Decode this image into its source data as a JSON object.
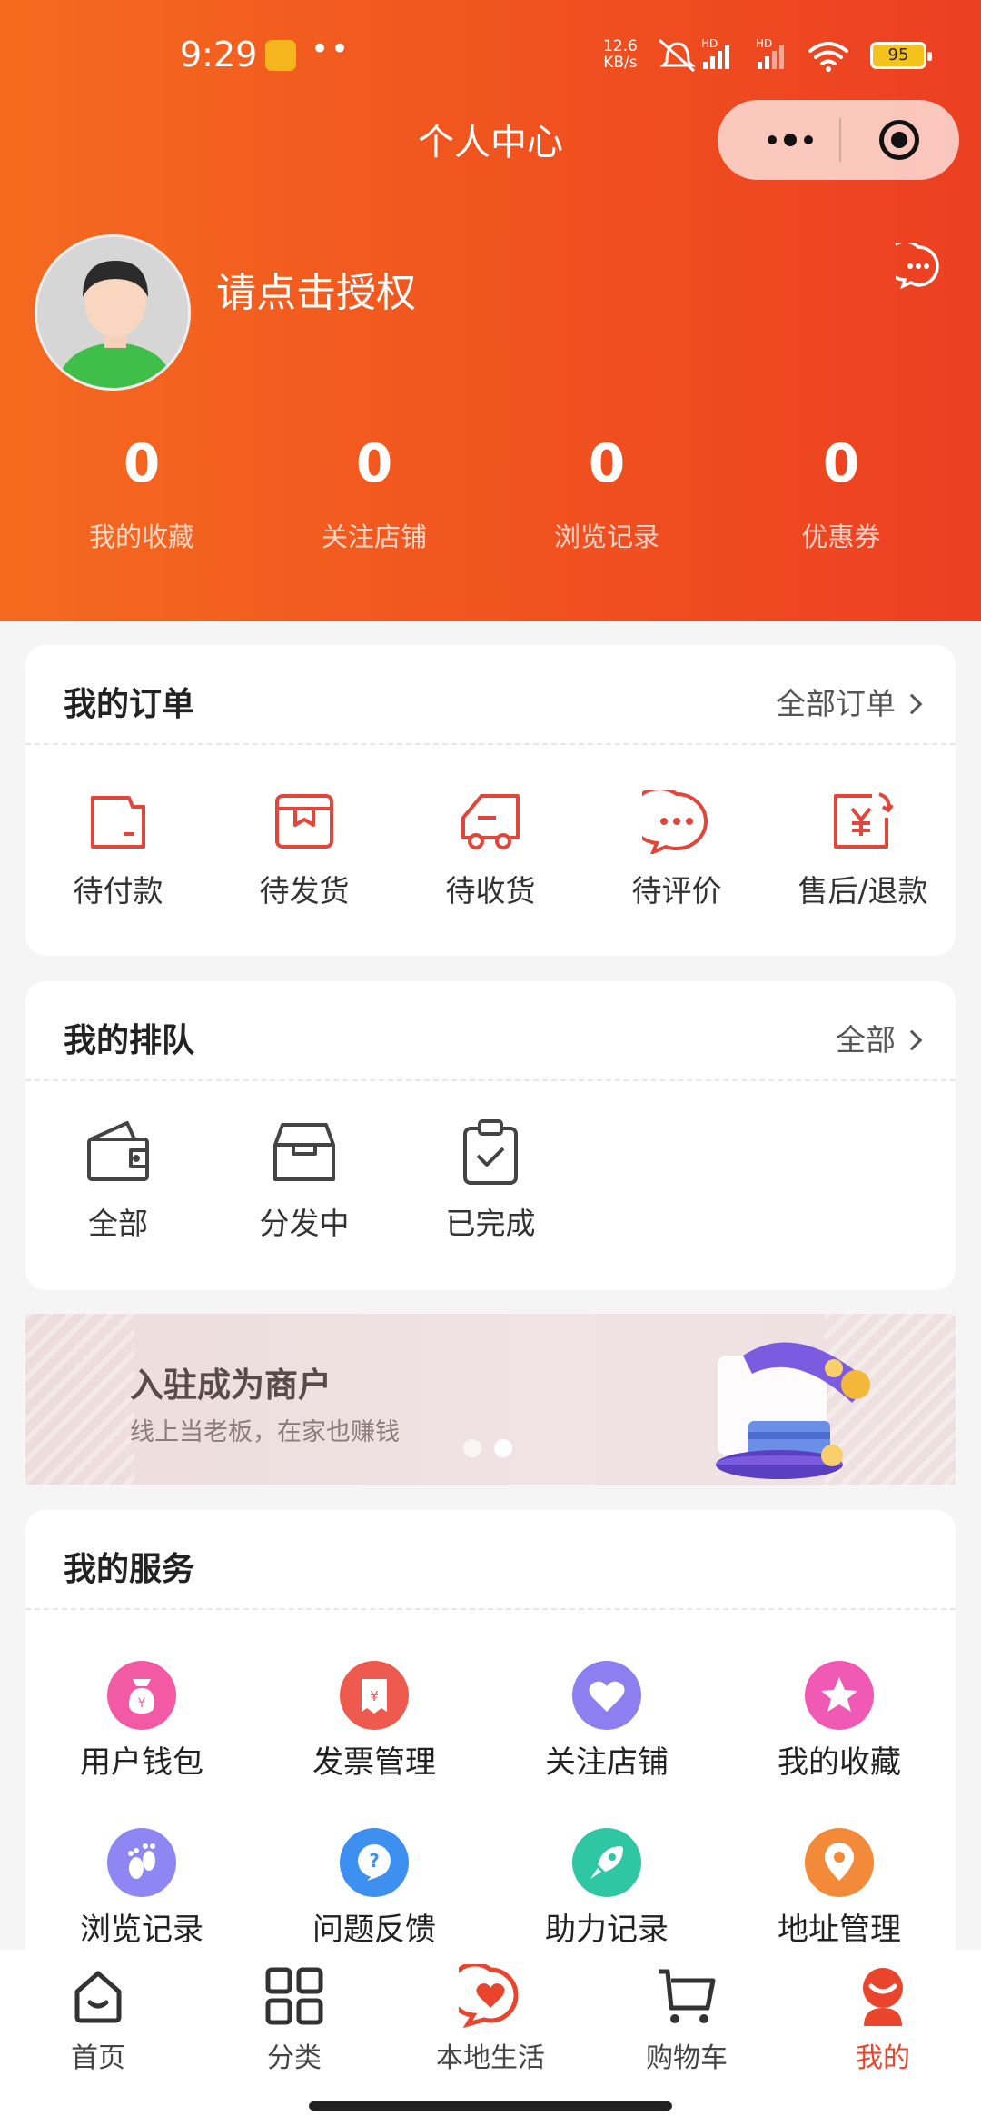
{
  "status_bar": {
    "time": "9:29",
    "network_speed_value": "12.6",
    "network_speed_unit": "KB/s",
    "signal_1": "HD",
    "signal_2": "HD",
    "battery": "95"
  },
  "header": {
    "title": "个人中心"
  },
  "profile": {
    "auth_prompt": "请点击授权"
  },
  "stats": [
    {
      "value": "0",
      "label": "我的收藏"
    },
    {
      "value": "0",
      "label": "关注店铺"
    },
    {
      "value": "0",
      "label": "浏览记录"
    },
    {
      "value": "0",
      "label": "优惠券"
    }
  ],
  "orders": {
    "title": "我的订单",
    "link": "全部订单",
    "items": [
      {
        "label": "待付款",
        "icon": "wallet-icon"
      },
      {
        "label": "待发货",
        "icon": "package-icon"
      },
      {
        "label": "待收货",
        "icon": "truck-icon"
      },
      {
        "label": "待评价",
        "icon": "chat-bubble-icon"
      },
      {
        "label": "售后/退款",
        "icon": "refund-icon"
      }
    ]
  },
  "queue": {
    "title": "我的排队",
    "link": "全部",
    "items": [
      {
        "label": "全部",
        "icon": "wallet-icon"
      },
      {
        "label": "分发中",
        "icon": "box-icon"
      },
      {
        "label": "已完成",
        "icon": "clipboard-check-icon"
      }
    ]
  },
  "banner": {
    "title": "入驻成为商户",
    "subtitle": "线上当老板，在家也赚钱"
  },
  "services": {
    "title": "我的服务",
    "items": [
      {
        "label": "用户钱包",
        "icon": "money-bag-icon",
        "color": "#f25aa6"
      },
      {
        "label": "发票管理",
        "icon": "invoice-icon",
        "color": "#ef5a4e"
      },
      {
        "label": "关注店铺",
        "icon": "heart-icon",
        "color": "#8d7ff0"
      },
      {
        "label": "我的收藏",
        "icon": "star-icon",
        "color": "#f05ab4"
      },
      {
        "label": "浏览记录",
        "icon": "footprint-icon",
        "color": "#8e86f2"
      },
      {
        "label": "问题反馈",
        "icon": "question-icon",
        "color": "#3d8ff0"
      },
      {
        "label": "助力记录",
        "icon": "rocket-icon",
        "color": "#2fc7a3"
      },
      {
        "label": "地址管理",
        "icon": "location-pin-icon",
        "color": "#f28a3a"
      }
    ]
  },
  "tabbar": {
    "items": [
      {
        "label": "首页",
        "icon": "home-icon"
      },
      {
        "label": "分类",
        "icon": "grid-icon"
      },
      {
        "label": "本地生活",
        "icon": "local-heart-icon"
      },
      {
        "label": "购物车",
        "icon": "cart-icon"
      },
      {
        "label": "我的",
        "icon": "profile-icon"
      }
    ],
    "active": "我的",
    "accent": "#e8452c"
  }
}
